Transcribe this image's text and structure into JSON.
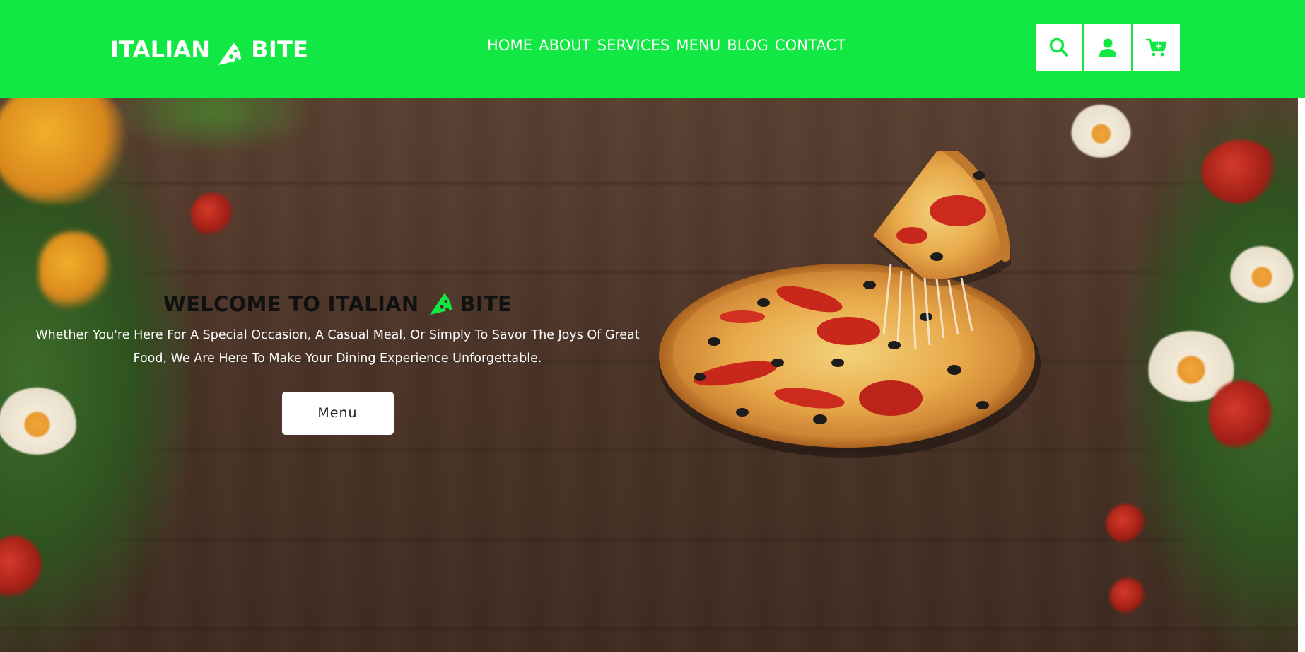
{
  "brand": {
    "name_left": "ITALIAN",
    "name_right": "BITE",
    "logo_icon": "pizza-slice-icon"
  },
  "nav": {
    "items": [
      {
        "label": "HOME"
      },
      {
        "label": "ABOUT"
      },
      {
        "label": "SERVICES"
      },
      {
        "label": "MENU"
      },
      {
        "label": "BLOG"
      },
      {
        "label": "CONTACT"
      }
    ]
  },
  "header_icons": [
    {
      "icon": "search-icon"
    },
    {
      "icon": "user-icon"
    },
    {
      "icon": "cart-add-icon"
    }
  ],
  "hero": {
    "title_left": "WELCOME TO ITALIAN",
    "title_right": "BITE",
    "description": "Whether You're Here For A Special Occasion, A Casual Meal, Or Simply To Savor The Joys Of Great Food, We Are Here To Make Your Dining Experience Unforgettable.",
    "button_label": "Menu"
  },
  "colors": {
    "accent": "#12e844",
    "header_text": "#ffffff",
    "title_text": "#111111"
  }
}
